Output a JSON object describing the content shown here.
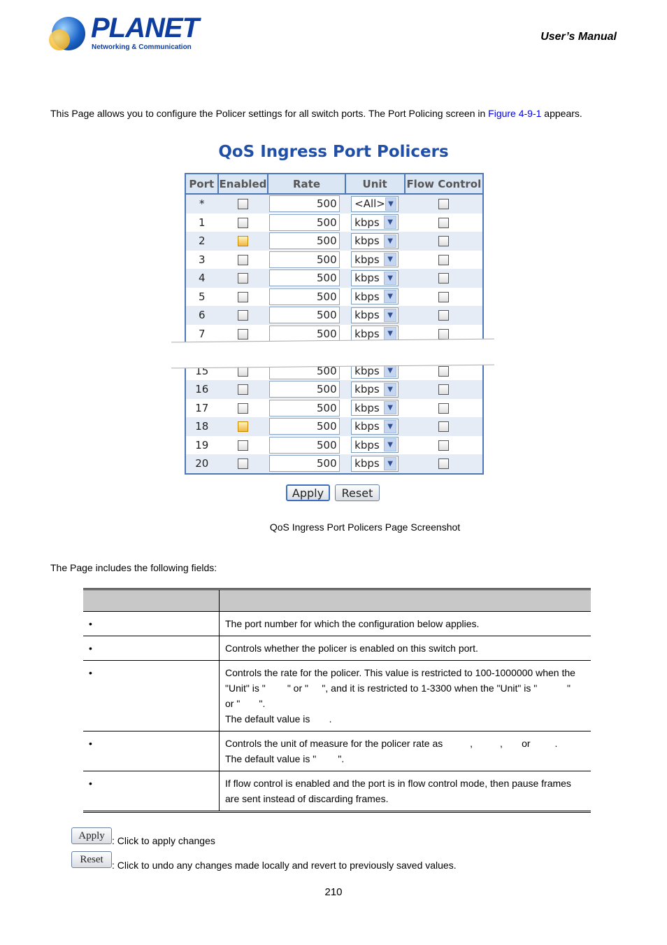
{
  "header": {
    "brand": "PLANET",
    "brand_sub": "Networking & Communication",
    "manual": "User’s  Manual"
  },
  "intro": {
    "text_before": "This Page allows you to configure the Policer settings for all switch ports. The Port Policing screen in ",
    "link": "Figure 4-9-1",
    "text_after": " appears."
  },
  "screenshot": {
    "title": "QoS Ingress Port Policers",
    "columns": [
      "Port",
      "Enabled",
      "Rate",
      "Unit",
      "Flow Control"
    ],
    "rows": [
      {
        "port": "*",
        "enabled": false,
        "rate": "500",
        "unit": "<All>",
        "flow": false
      },
      {
        "port": "1",
        "enabled": false,
        "rate": "500",
        "unit": "kbps",
        "flow": false
      },
      {
        "port": "2",
        "enabled": false,
        "rate": "500",
        "unit": "kbps",
        "flow": false,
        "focus": true
      },
      {
        "port": "3",
        "enabled": false,
        "rate": "500",
        "unit": "kbps",
        "flow": false
      },
      {
        "port": "4",
        "enabled": false,
        "rate": "500",
        "unit": "kbps",
        "flow": false
      },
      {
        "port": "5",
        "enabled": false,
        "rate": "500",
        "unit": "kbps",
        "flow": false
      },
      {
        "port": "6",
        "enabled": false,
        "rate": "500",
        "unit": "kbps",
        "flow": false
      },
      {
        "port": "7",
        "enabled": false,
        "rate": "500",
        "unit": "kbps",
        "flow": false
      },
      {
        "gap": true
      },
      {
        "port": "15",
        "enabled": false,
        "rate": "500",
        "unit": "kbps",
        "flow": false
      },
      {
        "port": "16",
        "enabled": false,
        "rate": "500",
        "unit": "kbps",
        "flow": false
      },
      {
        "port": "17",
        "enabled": false,
        "rate": "500",
        "unit": "kbps",
        "flow": false
      },
      {
        "port": "18",
        "enabled": false,
        "rate": "500",
        "unit": "kbps",
        "flow": false,
        "focus": true
      },
      {
        "port": "19",
        "enabled": false,
        "rate": "500",
        "unit": "kbps",
        "flow": false
      },
      {
        "port": "20",
        "enabled": false,
        "rate": "500",
        "unit": "kbps",
        "flow": false
      }
    ],
    "apply": "Apply",
    "reset": "Reset"
  },
  "caption": "QoS Ingress Port Policers Page Screenshot",
  "fields_intro": "The Page includes the following fields:",
  "fields": [
    "The port number for which the configuration below applies.",
    "Controls whether the policer is enabled on this switch port.",
    "Controls the rate for the policer. This value is restricted to 100-1000000 when the\n\"Unit\" is \"        \" or \"     \", and it is restricted to 1-3300 when the \"Unit\" is \"           \"\nor \"       \".\nThe default value is       .",
    "Controls the unit of measure for the policer rate as          ,          ,       or         .\nThe default value is \"        \".",
    "If flow control is enabled and the port is in flow control mode, then pause frames\nare sent instead of discarding frames."
  ],
  "buttons": [
    {
      "label": "Apply",
      "desc": ": Click to apply changes"
    },
    {
      "label": "Reset",
      "desc": ": Click to undo any changes made locally and revert to previously saved values."
    }
  ],
  "page_number": "210",
  "colors": {
    "title": "#1f4fa8",
    "table_border": "#4d78b8",
    "link": "#0000ee"
  }
}
